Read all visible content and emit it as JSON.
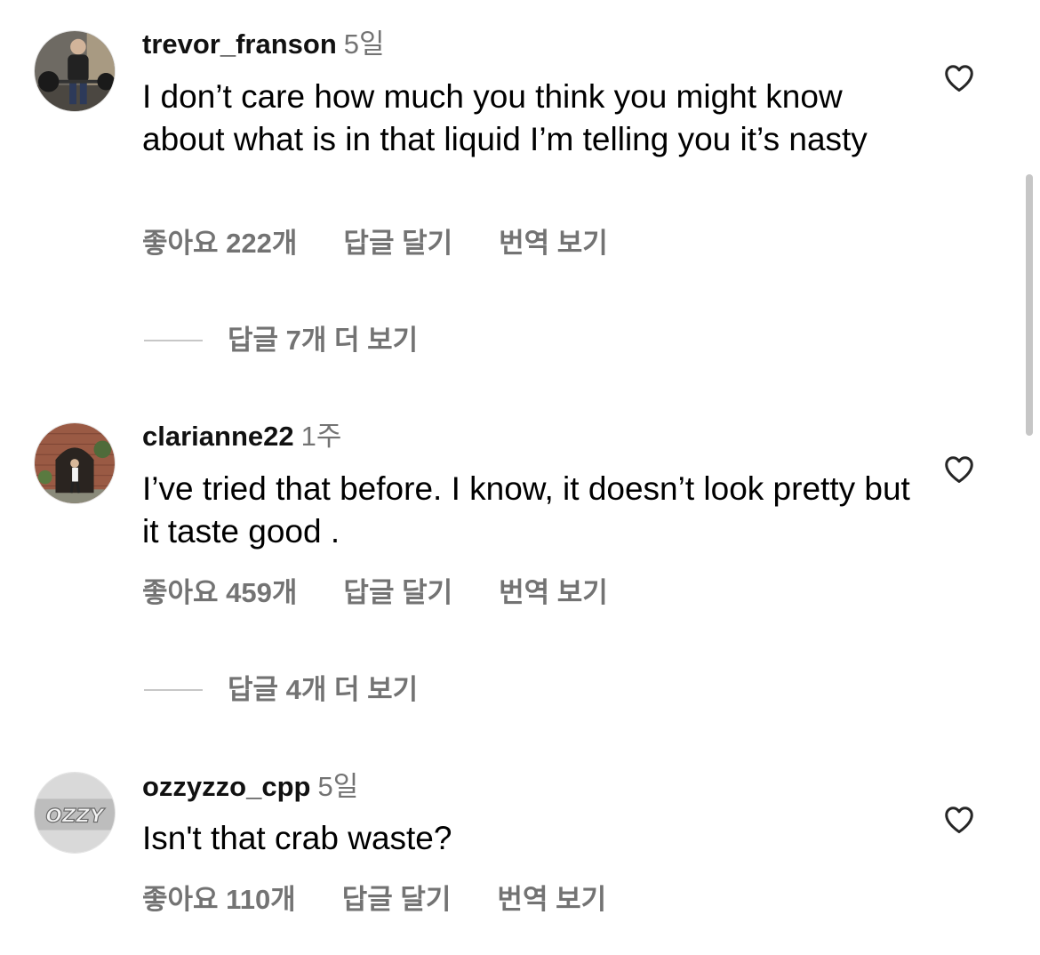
{
  "comments": [
    {
      "username": "trevor_franson",
      "time": "5일",
      "text": "I don’t care how much you think you might know about what is in that liquid I’m telling you it’s nasty",
      "likes": "좋아요 222개",
      "reply": "답글 달기",
      "translate": "번역 보기",
      "view_replies": "답글 7개 더 보기",
      "avatar_icon": "avatar-man-gym-icon"
    },
    {
      "username": "clarianne22",
      "time": "1주",
      "text": "I’ve tried that before. I know, it doesn’t look pretty but it taste good .",
      "likes": "좋아요 459개",
      "reply": "답글 달기",
      "translate": "번역 보기",
      "view_replies": "답글 4개 더 보기",
      "avatar_icon": "avatar-woman-arch-icon"
    },
    {
      "username": "ozzyzzo_cpp",
      "time": "5일",
      "text": "Isn't that crab waste?",
      "likes": "좋아요 110개",
      "reply": "답글 달기",
      "translate": "번역 보기",
      "avatar_icon": "avatar-graffiti-logo-icon",
      "avatar_text": "OZZY"
    }
  ],
  "colors": {
    "text": "#000000",
    "secondary": "#737373",
    "divider": "#c7c7c7",
    "heart_stroke": "#262626"
  },
  "icons": {
    "like": "heart-outline-icon"
  }
}
